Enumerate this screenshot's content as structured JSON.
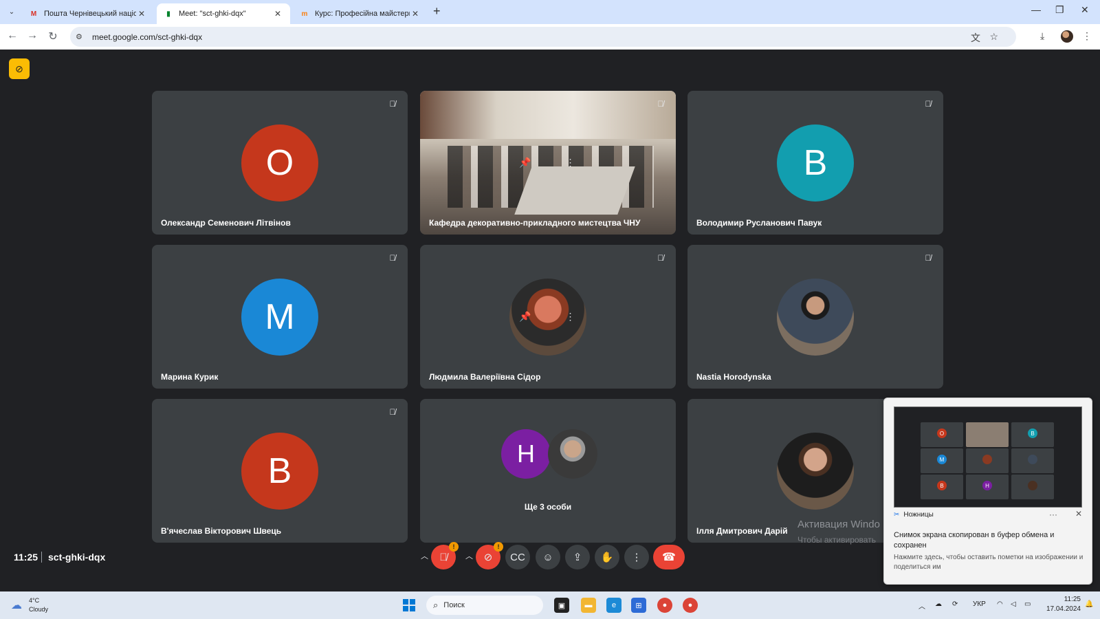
{
  "browser": {
    "tabs": [
      {
        "title": "Пошта Чернівецький націона...",
        "favicon": "gmail-icon",
        "active": false
      },
      {
        "title": "Meet: \"sct-ghki-dqx\"",
        "favicon": "meet-icon",
        "active": true
      },
      {
        "title": "Курс: Професійна майстерніст...",
        "favicon": "moodle-icon",
        "active": false
      }
    ],
    "url": "meet.google.com/sct-ghki-dqx"
  },
  "meet": {
    "tiles": [
      {
        "name": "Олександр Семенович Літвінов",
        "initial": "О",
        "color": "#c5371c",
        "muted": true
      },
      {
        "name": "Кафедра декоративно-прикладного мистецтва ЧНУ",
        "video": true,
        "muted": true
      },
      {
        "name": "Володимир Русланович Павук",
        "initial": "В",
        "color": "#129eaf",
        "muted": true
      },
      {
        "name": "Марина Курик",
        "initial": "М",
        "color": "#1a88d6",
        "muted": true
      },
      {
        "name": "Людмила Валеріївна Сідор",
        "photo": true,
        "muted": true
      },
      {
        "name": "Nastia Horodynska",
        "photo": true,
        "muted": true
      },
      {
        "name": "В'ячеслав Вікторович Швець",
        "initial": "В",
        "color": "#c5371c",
        "muted": true
      },
      {
        "name": "Ще 3 особи",
        "group": true,
        "initial": "Н",
        "color": "#7b1fa2"
      },
      {
        "name": "Ілля Дмитрович Дарій",
        "photo": true
      }
    ],
    "clock": "11:25",
    "meeting_code": "sct-ghki-dqx",
    "badge_mic": "!",
    "badge_cam": "!"
  },
  "activation": {
    "title": "Активация Windo",
    "subtitle": "Чтобы активировать"
  },
  "snip": {
    "app": "Ножницы",
    "message": "Снимок экрана скопирован в буфер обмена и сохранен",
    "sub": "Нажмите здесь, чтобы оставить пометки на изображении и поделиться им"
  },
  "taskbar": {
    "temperature": "4°C",
    "weather": "Cloudy",
    "search_placeholder": "Поиск",
    "lang": "УКР",
    "time": "11:25",
    "date": "17.04.2024"
  }
}
